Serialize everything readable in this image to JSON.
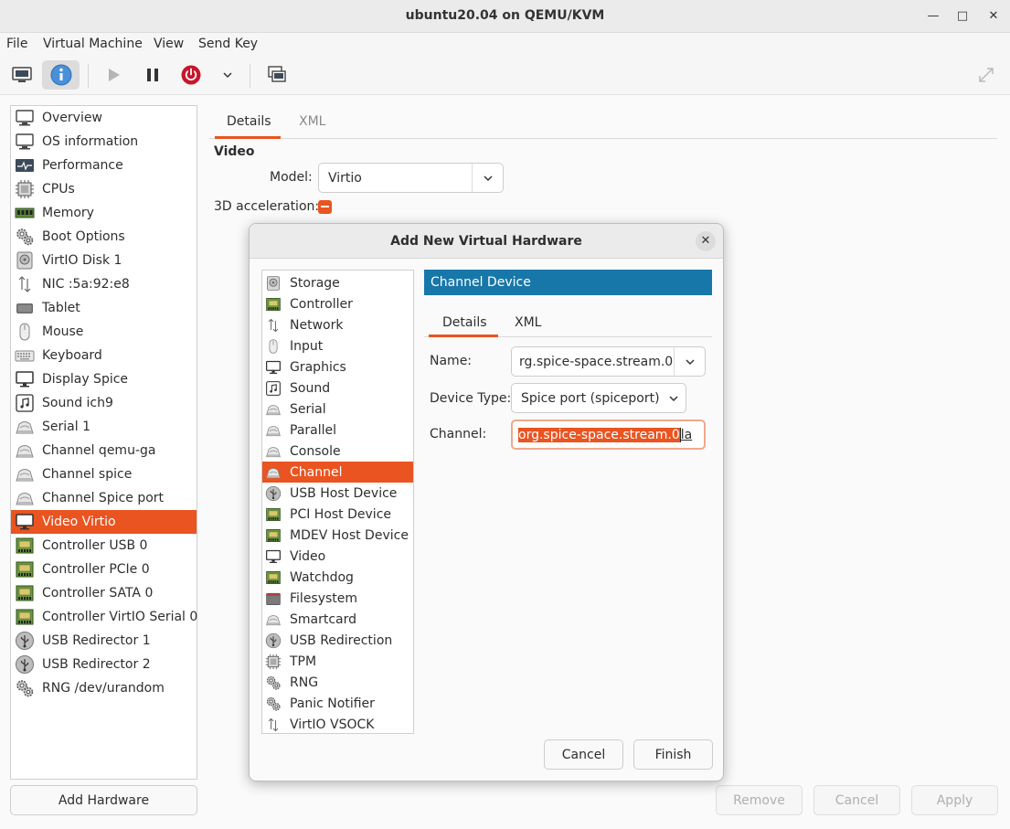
{
  "window": {
    "title": "ubuntu20.04 on QEMU/KVM"
  },
  "menu": [
    "File",
    "Virtual Machine",
    "View",
    "Send Key"
  ],
  "hardware_list": [
    {
      "label": "Overview",
      "icon": "monitor-icon"
    },
    {
      "label": "OS information",
      "icon": "monitor-icon"
    },
    {
      "label": "Performance",
      "icon": "performance-icon"
    },
    {
      "label": "CPUs",
      "icon": "cpu-icon"
    },
    {
      "label": "Memory",
      "icon": "memory-icon"
    },
    {
      "label": "Boot Options",
      "icon": "gear-icon"
    },
    {
      "label": "VirtIO Disk 1",
      "icon": "disk-icon"
    },
    {
      "label": "NIC :5a:92:e8",
      "icon": "network-icon"
    },
    {
      "label": "Tablet",
      "icon": "tablet-icon"
    },
    {
      "label": "Mouse",
      "icon": "mouse-icon"
    },
    {
      "label": "Keyboard",
      "icon": "keyboard-icon"
    },
    {
      "label": "Display Spice",
      "icon": "display-icon"
    },
    {
      "label": "Sound ich9",
      "icon": "sound-icon"
    },
    {
      "label": "Serial 1",
      "icon": "serial-icon"
    },
    {
      "label": "Channel qemu-ga",
      "icon": "serial-icon"
    },
    {
      "label": "Channel spice",
      "icon": "serial-icon"
    },
    {
      "label": "Channel Spice port",
      "icon": "serial-icon"
    },
    {
      "label": "Video Virtio",
      "icon": "display-icon",
      "selected": true
    },
    {
      "label": "Controller USB 0",
      "icon": "controller-icon"
    },
    {
      "label": "Controller PCIe 0",
      "icon": "controller-icon"
    },
    {
      "label": "Controller SATA 0",
      "icon": "controller-icon"
    },
    {
      "label": "Controller VirtIO Serial 0",
      "icon": "controller-icon"
    },
    {
      "label": "USB Redirector 1",
      "icon": "usb-icon"
    },
    {
      "label": "USB Redirector 2",
      "icon": "usb-icon"
    },
    {
      "label": "RNG /dev/urandom",
      "icon": "gear-icon"
    }
  ],
  "buttons": {
    "add_hardware": "Add Hardware",
    "remove": "Remove",
    "cancel": "Cancel",
    "apply": "Apply"
  },
  "main_tabs": {
    "details": "Details",
    "xml": "XML"
  },
  "video": {
    "section": "Video",
    "model_label": "Model:",
    "model_value": "Virtio",
    "accel_label": "3D acceleration:"
  },
  "dialog": {
    "title": "Add New Virtual Hardware",
    "list": [
      {
        "label": "Storage",
        "icon": "disk-icon"
      },
      {
        "label": "Controller",
        "icon": "controller-icon"
      },
      {
        "label": "Network",
        "icon": "network-icon"
      },
      {
        "label": "Input",
        "icon": "mouse-icon"
      },
      {
        "label": "Graphics",
        "icon": "display-icon"
      },
      {
        "label": "Sound",
        "icon": "sound-icon"
      },
      {
        "label": "Serial",
        "icon": "serial-icon"
      },
      {
        "label": "Parallel",
        "icon": "serial-icon"
      },
      {
        "label": "Console",
        "icon": "serial-icon"
      },
      {
        "label": "Channel",
        "icon": "serial-icon",
        "selected": true
      },
      {
        "label": "USB Host Device",
        "icon": "usb-icon"
      },
      {
        "label": "PCI Host Device",
        "icon": "controller-icon"
      },
      {
        "label": "MDEV Host Device",
        "icon": "controller-icon"
      },
      {
        "label": "Video",
        "icon": "display-icon"
      },
      {
        "label": "Watchdog",
        "icon": "controller-icon"
      },
      {
        "label": "Filesystem",
        "icon": "filesystem-icon"
      },
      {
        "label": "Smartcard",
        "icon": "serial-icon"
      },
      {
        "label": "USB Redirection",
        "icon": "usb-icon"
      },
      {
        "label": "TPM",
        "icon": "cpu-icon"
      },
      {
        "label": "RNG",
        "icon": "gear-icon"
      },
      {
        "label": "Panic Notifier",
        "icon": "gear-icon"
      },
      {
        "label": "VirtIO VSOCK",
        "icon": "network-icon"
      }
    ],
    "header": "Channel Device",
    "tabs": {
      "details": "Details",
      "xml": "XML"
    },
    "name_label": "Name:",
    "name_value": "rg.spice-space.stream.0",
    "device_type_label": "Device Type:",
    "device_type_value": "Spice port (spiceport)",
    "channel_label": "Channel:",
    "channel_selected": "org.spice-space.stream.0",
    "channel_rest": "la",
    "cancel": "Cancel",
    "finish": "Finish"
  },
  "colors": {
    "accent": "#e95420",
    "header_blue": "#1877a9",
    "info_blue": "#4a90d9"
  }
}
